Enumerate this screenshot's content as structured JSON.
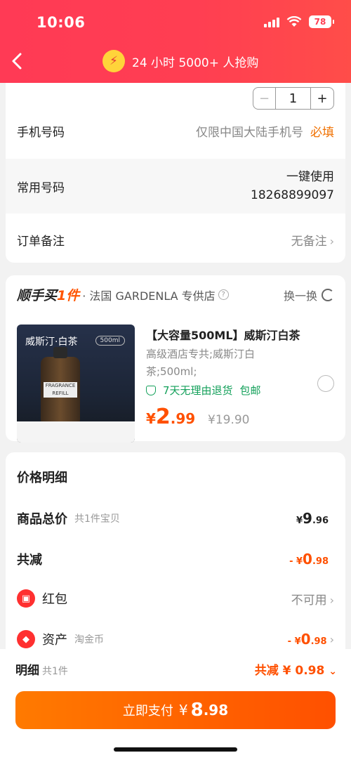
{
  "status": {
    "time": "10:06",
    "battery": "78"
  },
  "nav": {
    "title": "24 小时 5000+ 人抢购"
  },
  "quantity": {
    "value": "1",
    "minus": "−",
    "plus": "+"
  },
  "form": {
    "phone_label": "手机号码",
    "phone_placeholder": "仅限中国大陆手机号",
    "required_label": "必填",
    "common_label": "常用号码",
    "common_action": "一键使用",
    "common_number": "18268899097",
    "note_label": "订单备注",
    "note_value": "无备注"
  },
  "shop": {
    "logo_main": "顺手买",
    "logo_one": "1件",
    "name": "· 法国 GARDENLA 专供店",
    "swap_label": "换一换"
  },
  "product": {
    "image_title": "威斯汀·白茶",
    "image_volume": "500ml",
    "image_label": "FRAGRANCE REFILL",
    "name": "【大容量500ML】威斯汀白茶",
    "desc": "高级酒店专共;威斯汀白茶;500ml;",
    "tag_return": "7天无理由退货",
    "tag_shipping": "包邮",
    "price_symbol": "¥",
    "price_int": "2",
    "price_dec": ".99",
    "orig_price": "¥19.90"
  },
  "price_detail": {
    "title": "价格明细",
    "total_label": "商品总价",
    "total_sub": "共1件宝贝",
    "total_yen": "¥",
    "total_int": "9",
    "total_dec": ".96",
    "reduce_label": "共减",
    "reduce_prefix": "- ¥",
    "reduce_int": "0",
    "reduce_dec": ".98",
    "redpacket_label": "红包",
    "redpacket_value": "不可用",
    "asset_label": "资产",
    "asset_sub": "淘金币",
    "asset_prefix": "- ¥",
    "asset_int": "0",
    "asset_dec": ".98"
  },
  "bottom": {
    "detail_label": "明细",
    "detail_count": "共1件",
    "reduce_summary": "共减 ¥ 0.98",
    "pay_label": "立即支付",
    "pay_yen": "¥",
    "pay_int": "8",
    "pay_dec": ".98"
  },
  "colors": {
    "accent": "#ff5000",
    "header": "#ff3e52",
    "green": "#13a05a"
  },
  "icons": [
    "back-icon",
    "shopping-bag-icon",
    "refresh-icon",
    "shield-check-icon",
    "red-packet-icon",
    "coin-tag-icon",
    "chevron-right-icon",
    "double-chevron-down-icon"
  ]
}
